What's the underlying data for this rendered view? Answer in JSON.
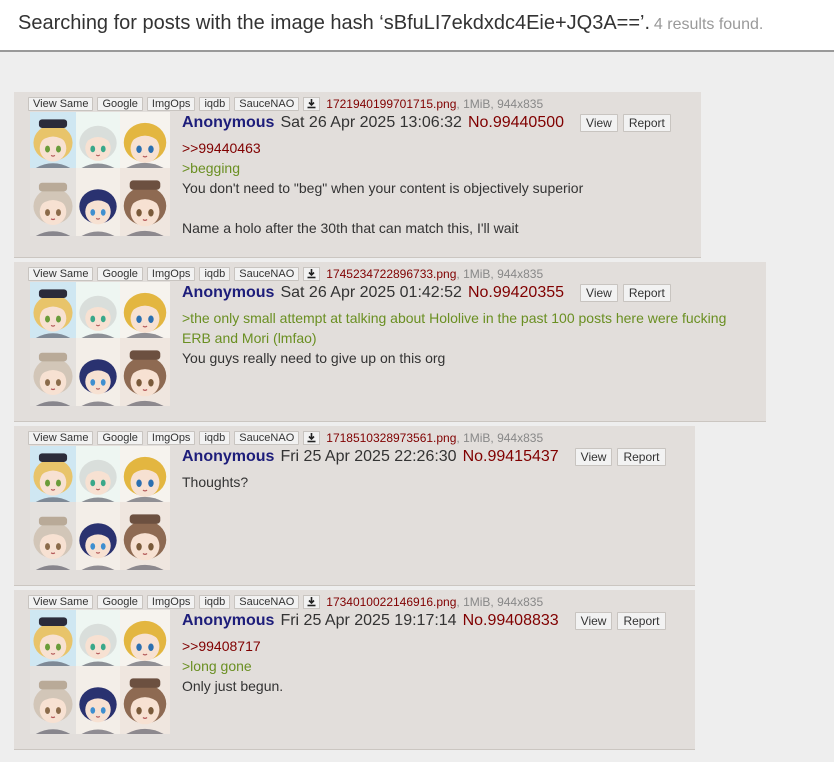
{
  "search": {
    "title": "Searching for posts with the image hash ‘sBfuLI7ekdxdc4Eie+JQ3A==’.",
    "count": "4 results found."
  },
  "colors": {
    "post_bg": "#e2dedb",
    "name": "#1d1d7a",
    "postno": "#800000",
    "quotelink": "#800000",
    "greentext": "#6a8f22"
  },
  "common": {
    "meta_buttons": [
      "View Same",
      "Google",
      "ImgOps",
      "iqdb",
      "SauceNAO"
    ],
    "download_icon": "download-icon",
    "view_label": "View",
    "report_label": "Report"
  },
  "posts": [
    {
      "filename": "1721940199701715.png",
      "fileinfo": ", 1MiB, 944x835",
      "name": "Anonymous",
      "date": "Sat 26 Apr 2025 13:06:32",
      "number": "No.99440500",
      "lines": [
        {
          "type": "quotelink",
          "text": ">>99440463"
        },
        {
          "type": "greentext",
          "text": ">begging"
        },
        {
          "type": "text",
          "text": "You don't need to \"beg\" when your content is objectively superior"
        },
        {
          "type": "text",
          "text": ""
        },
        {
          "type": "text",
          "text": "Name a holo after the 30th that can match this, I'll wait"
        }
      ]
    },
    {
      "filename": "1745234722896733.png",
      "fileinfo": ", 1MiB, 944x835",
      "name": "Anonymous",
      "date": "Sat 26 Apr 2025 01:42:52",
      "number": "No.99420355",
      "lines": [
        {
          "type": "greentext",
          "text": ">the only small attempt at talking about Hololive in the past 100 posts here were fucking"
        },
        {
          "type": "greentext",
          "text": "ERB and Mori (lmfao)"
        },
        {
          "type": "text",
          "text": "You guys really need to give up on this org"
        }
      ]
    },
    {
      "filename": "1718510328973561.png",
      "fileinfo": ", 1MiB, 944x835",
      "name": "Anonymous",
      "date": "Fri 25 Apr 2025 22:26:30",
      "number": "No.99415437",
      "lines": [
        {
          "type": "text",
          "text": "Thoughts?"
        }
      ]
    },
    {
      "filename": "1734010022146916.png",
      "fileinfo": ", 1MiB, 944x835",
      "name": "Anonymous",
      "date": "Fri 25 Apr 2025 19:17:14",
      "number": "No.99408833",
      "lines": [
        {
          "type": "quotelink",
          "text": ">>99408717"
        },
        {
          "type": "greentext",
          "text": ">long gone"
        },
        {
          "type": "text",
          "text": "Only just begun."
        }
      ]
    }
  ]
}
